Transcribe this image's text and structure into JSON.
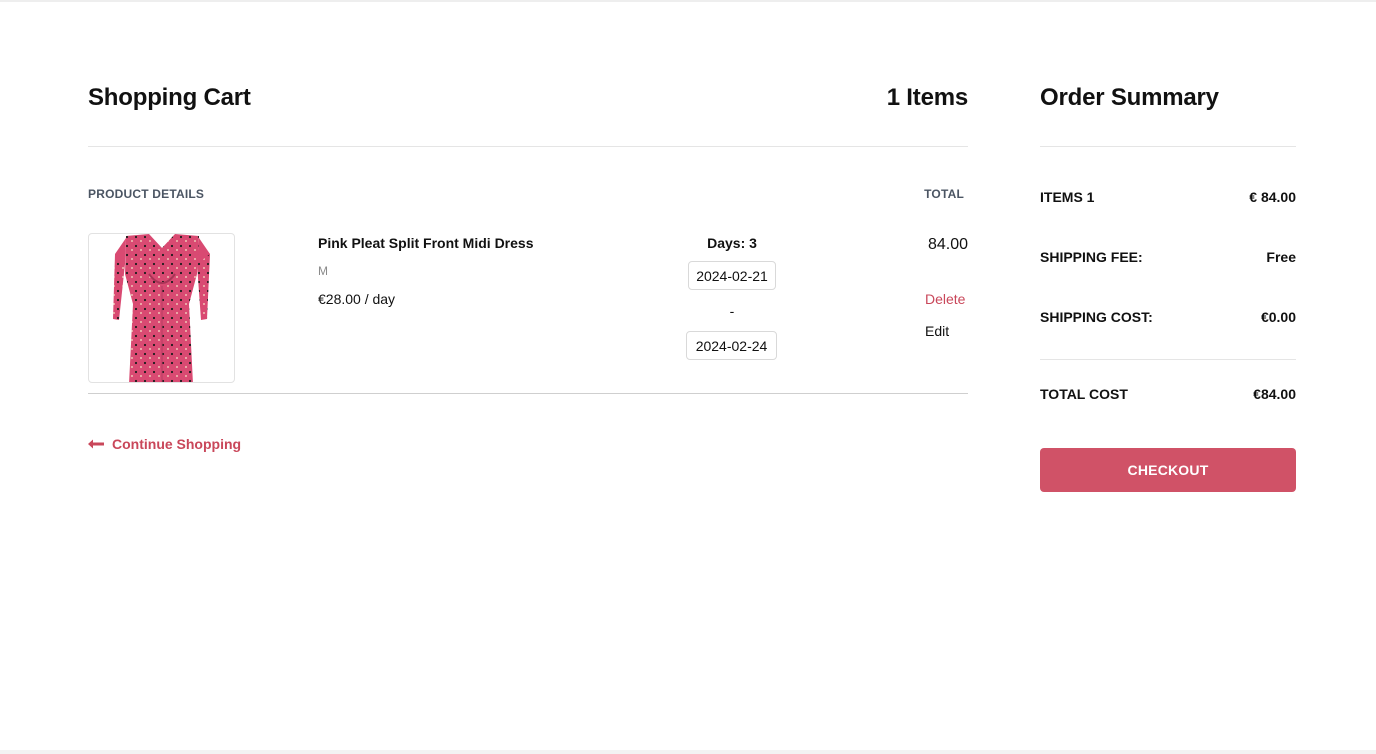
{
  "cart": {
    "title": "Shopping Cart",
    "items_count_label": "1 Items",
    "column_product": "PRODUCT DETAILS",
    "column_total": "TOTAL",
    "items": [
      {
        "name": "Pink Pleat Split Front Midi Dress",
        "size": "M",
        "price_per_day": "€28.00 / day",
        "days_label": "Days: 3",
        "start_date": "2024-02-21",
        "date_separator": "-",
        "end_date": "2024-02-24",
        "total": "84.00",
        "delete_label": "Delete",
        "edit_label": "Edit",
        "image_colors": {
          "dress": "#d94a72",
          "dots": "#1c1c1c"
        }
      }
    ],
    "continue_label": "Continue Shopping",
    "continue_icon": "arrow-left-icon"
  },
  "summary": {
    "title": "Order Summary",
    "rows": [
      {
        "label": "ITEMS 1",
        "value": "€ 84.00"
      },
      {
        "label": "SHIPPING FEE:",
        "value": "Free"
      },
      {
        "label": "SHIPPING COST:",
        "value": "€0.00"
      }
    ],
    "total_label": "TOTAL COST",
    "total_value": "€84.00",
    "checkout_label": "CHECKOUT"
  },
  "colors": {
    "accent": "#d05267",
    "accent_text": "#c9475a"
  }
}
